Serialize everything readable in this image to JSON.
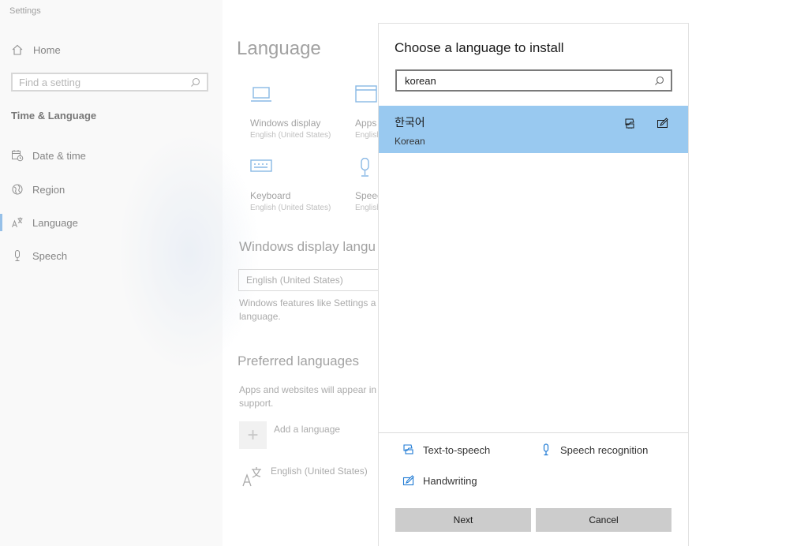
{
  "window": {
    "title": "Settings"
  },
  "sidebar": {
    "home": "Home",
    "search_placeholder": "Find a setting",
    "section": "Time & Language",
    "items": [
      {
        "label": "Date & time",
        "icon": "calendar-clock-icon"
      },
      {
        "label": "Region",
        "icon": "globe-icon"
      },
      {
        "label": "Language",
        "icon": "language-icon",
        "active": true
      },
      {
        "label": "Speech",
        "icon": "microphone-icon"
      }
    ]
  },
  "page": {
    "title": "Language",
    "tiles": [
      {
        "label": "Windows display",
        "sub": "English (United States)",
        "icon": "laptop-icon"
      },
      {
        "label": "Apps",
        "sub": "English",
        "icon": "window-icon"
      },
      {
        "label": "Keyboard",
        "sub": "English (United States)",
        "icon": "keyboard-icon"
      },
      {
        "label": "Speech",
        "sub": "English",
        "icon": "microphone-icon"
      }
    ],
    "display_language_heading": "Windows display langu",
    "display_language_value": "English (United States)",
    "display_language_desc_1": "Windows features like Settings a",
    "display_language_desc_2": "language.",
    "preferred_heading": "Preferred languages",
    "preferred_desc_1": "Apps and websites will appear in",
    "preferred_desc_2": "support.",
    "add_language": "Add a language",
    "installed_language": "English (United States)"
  },
  "dialog": {
    "title": "Choose a language to install",
    "search_value": "korean",
    "results": [
      {
        "native": "한국어",
        "english": "Korean",
        "selected": true
      }
    ],
    "features": {
      "tts": "Text-to-speech",
      "speech": "Speech recognition",
      "handwriting": "Handwriting"
    },
    "next": "Next",
    "cancel": "Cancel"
  },
  "colors": {
    "accent": "#0078d7",
    "selection": "#99c9f0",
    "button": "#cccccc"
  }
}
